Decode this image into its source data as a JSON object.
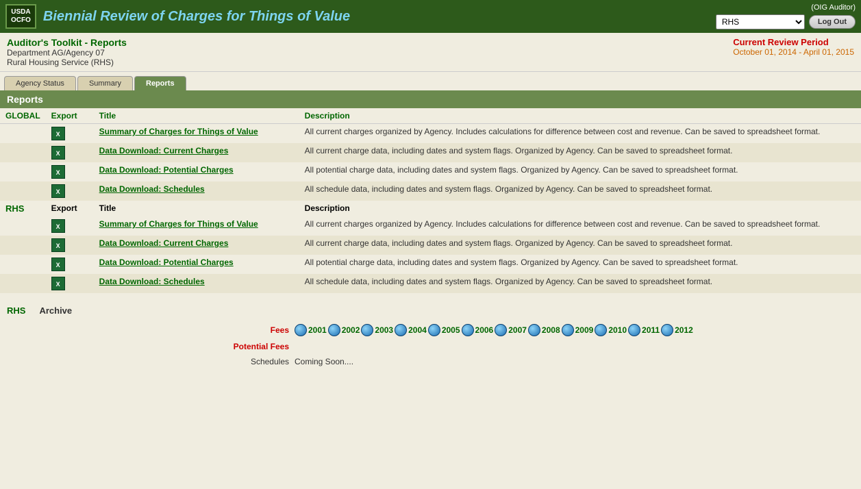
{
  "header": {
    "usda_line1": "USDA",
    "usda_line2": "OCFO",
    "title": "Biennial Review of Charges for Things of Value",
    "oig_label": "(OIG Auditor)",
    "agency_selected": "RHS",
    "agency_options": [
      "RHS"
    ],
    "logout_label": "Log Out"
  },
  "info": {
    "toolkit_title": "Auditor's Toolkit - Reports",
    "dept_label": "Department AG/Agency 07",
    "agency_label": "Rural Housing Service (RHS)",
    "review_label": "Current Review Period",
    "review_period": "October 01, 2014 - April 01, 2015"
  },
  "tabs": [
    {
      "label": "Agency Status",
      "active": false
    },
    {
      "label": "Summary",
      "active": false
    },
    {
      "label": "Reports",
      "active": true
    }
  ],
  "reports_header": "Reports",
  "columns": {
    "global": "GLOBAL",
    "export": "Export",
    "title": "Title",
    "description": "Description"
  },
  "global_section": {
    "label": "GLOBAL",
    "rows": [
      {
        "link": "Summary of Charges for Things of Value",
        "desc": "All current charges organized by Agency. Includes calculations for difference between cost and revenue. Can be saved to spreadsheet format."
      },
      {
        "link": "Data Download: Current Charges",
        "desc": "All current charge data, including dates and system flags. Organized by Agency. Can be saved to spreadsheet format."
      },
      {
        "link": "Data Download: Potential Charges",
        "desc": "All potential charge data, including dates and system flags. Organized by Agency. Can be saved to spreadsheet format."
      },
      {
        "link": "Data Download: Schedules",
        "desc": "All schedule data, including dates and system flags. Organized by Agency. Can be saved to spreadsheet format."
      }
    ]
  },
  "rhs_section": {
    "label": "RHS",
    "export_col": "Export",
    "title_col": "Title",
    "desc_col": "Description",
    "rows": [
      {
        "link": "Summary of Charges for Things of Value",
        "desc": "All current charges organized by Agency. Includes calculations for difference between cost and revenue. Can be saved to spreadsheet format."
      },
      {
        "link": "Data Download: Current Charges",
        "desc": "All current charge data, including dates and system flags. Organized by Agency. Can be saved to spreadsheet format."
      },
      {
        "link": "Data Download: Potential Charges",
        "desc": "All potential charge data, including dates and system flags. Organized by Agency. Can be saved to spreadsheet format."
      },
      {
        "link": "Data Download: Schedules",
        "desc": "All schedule data, including dates and system flags. Organized by Agency. Can be saved to spreadsheet format."
      }
    ]
  },
  "archive": {
    "section_label": "RHS",
    "archive_label": "Archive",
    "fees_label": "Fees",
    "potential_fees_label": "Potential Fees",
    "schedules_label": "Schedules",
    "coming_soon": "Coming Soon....",
    "years": [
      "2001",
      "2002",
      "2003",
      "2004",
      "2005",
      "2006",
      "2007",
      "2008",
      "2009",
      "2010",
      "2011",
      "2012"
    ]
  }
}
